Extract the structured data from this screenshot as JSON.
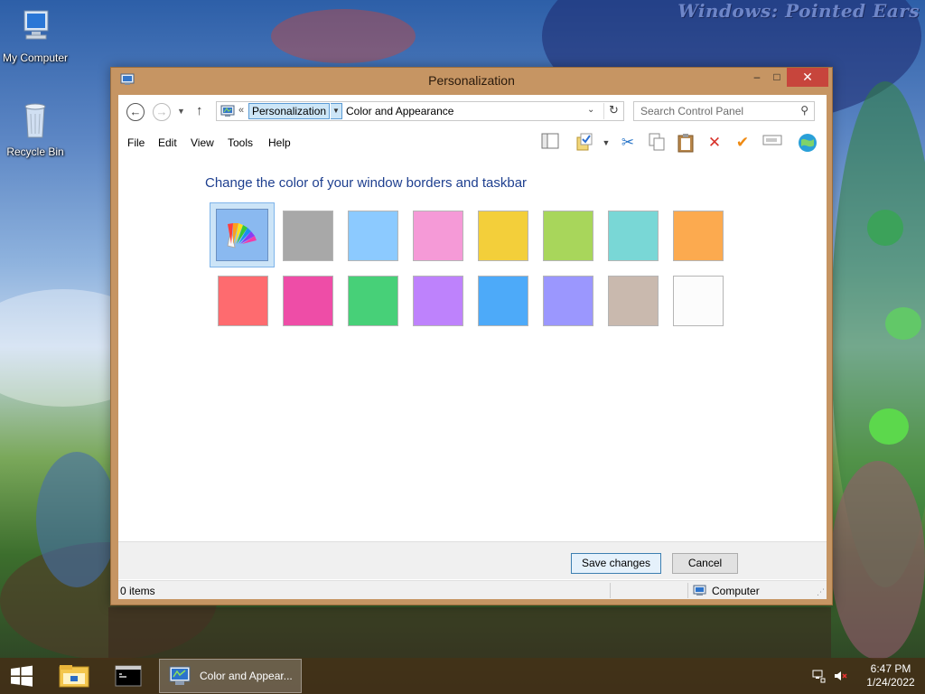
{
  "desktop": {
    "wallpaper_title": "Windows: Pointed Ears",
    "icons": [
      {
        "label": "My Computer",
        "icon": "computer-icon"
      },
      {
        "label": "Recycle Bin",
        "icon": "recycle-bin-icon"
      }
    ]
  },
  "window": {
    "title": "Personalization",
    "controls": {
      "minimize": "–",
      "maximize": "□",
      "close": "✕"
    },
    "address": {
      "overflow": "«",
      "crumbs": [
        "Personalization",
        "Color and Appearance"
      ]
    },
    "search": {
      "placeholder": "Search Control Panel"
    },
    "menu": [
      "File",
      "Edit",
      "View",
      "Tools",
      "Help"
    ],
    "toolbar_icons": [
      "layout-pane-icon",
      "checklist-folder-icon",
      "cut-icon",
      "copy-icon",
      "paste-icon",
      "delete-icon",
      "properties-check-icon",
      "rename-icon",
      "globe-icon"
    ],
    "heading": "Change the color of your window borders and taskbar",
    "colors": {
      "selected": "automatic",
      "row1": [
        "automatic",
        "#a8a8a8",
        "#8ccaff",
        "#f59ad7",
        "#f3cf3a",
        "#a8d65b",
        "#79d7d6",
        "#fcaa4f"
      ],
      "row2": [
        "#fe6b6f",
        "#ee4da7",
        "#47d078",
        "#be82fc",
        "#4daaf9",
        "#9b97fe",
        "#c9b9ae",
        "#fcfcfc"
      ]
    },
    "buttons": {
      "save": "Save changes",
      "cancel": "Cancel"
    },
    "status": {
      "items": "0 items",
      "location": "Computer"
    }
  },
  "taskbar": {
    "active_task": "Color and Appear...",
    "clock": {
      "time": "6:47 PM",
      "date": "1/24/2022"
    }
  }
}
